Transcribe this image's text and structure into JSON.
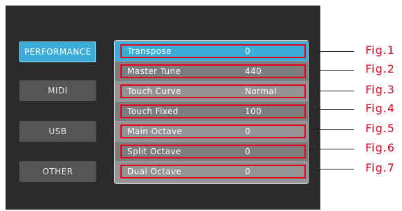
{
  "sidebar": {
    "items": [
      {
        "label": "PERFORMANCE",
        "active": true
      },
      {
        "label": "MIDI",
        "active": false
      },
      {
        "label": "USB",
        "active": false
      },
      {
        "label": "OTHER",
        "active": false
      }
    ]
  },
  "settings": {
    "rows": [
      {
        "label": "Transpose",
        "value": "0"
      },
      {
        "label": "Master Tune",
        "value": "440"
      },
      {
        "label": "Touch Curve",
        "value": "Normal"
      },
      {
        "label": "Touch Fixed",
        "value": "100"
      },
      {
        "label": "Main Octave",
        "value": "0"
      },
      {
        "label": "Split Octave",
        "value": "0"
      },
      {
        "label": "Dual Octave",
        "value": "0"
      }
    ]
  },
  "callouts": [
    "Fig.1",
    "Fig.2",
    "Fig.3",
    "Fig.4",
    "Fig.5",
    "Fig.6",
    "Fig.7"
  ],
  "colors": {
    "accent": "#3aaed8",
    "highlight": "#e2001a",
    "panel": "#2b2b2b"
  }
}
